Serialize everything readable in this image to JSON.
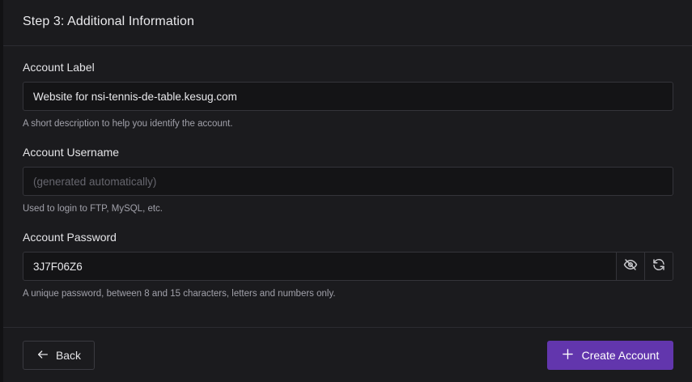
{
  "header": {
    "title": "Step 3: Additional Information"
  },
  "fields": {
    "label": {
      "label": "Account Label",
      "value": "Website for nsi-tennis-de-table.kesug.com",
      "help": "A short description to help you identify the account."
    },
    "username": {
      "label": "Account Username",
      "placeholder": "(generated automatically)",
      "help": "Used to login to FTP, MySQL, etc."
    },
    "password": {
      "label": "Account Password",
      "value": "3J7F06Z6",
      "help": "A unique password, between 8 and 15 characters, letters and numbers only.",
      "toggle_icon": "eye-off-icon",
      "regenerate_icon": "refresh-icon"
    }
  },
  "footer": {
    "back_label": "Back",
    "back_icon": "arrow-left-icon",
    "create_label": "Create Account",
    "create_icon": "plus-icon"
  },
  "colors": {
    "background": "#1b1b1e",
    "accent": "#6236ad"
  }
}
